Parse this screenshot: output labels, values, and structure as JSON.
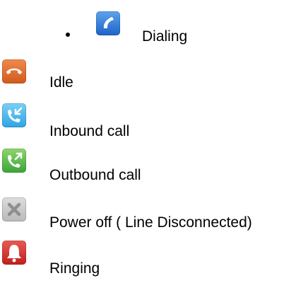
{
  "items": [
    {
      "label": "Dialing",
      "icon": "dialing-phone-icon",
      "color": "#2f7fd8"
    },
    {
      "label": "Idle",
      "icon": "idle-hangup-icon",
      "color": "#e0703a"
    },
    {
      "label": "Inbound call",
      "icon": "inbound-call-icon",
      "color": "#46b5ee"
    },
    {
      "label": "Outbound call",
      "icon": "outbound-call-icon",
      "color": "#5bbd4a"
    },
    {
      "label": "Power off ( Line Disconnected)",
      "icon": "power-off-x-icon",
      "color": "#c8c8c8"
    },
    {
      "label": "Ringing",
      "icon": "ringing-bell-icon",
      "color": "#d63a34"
    }
  ]
}
